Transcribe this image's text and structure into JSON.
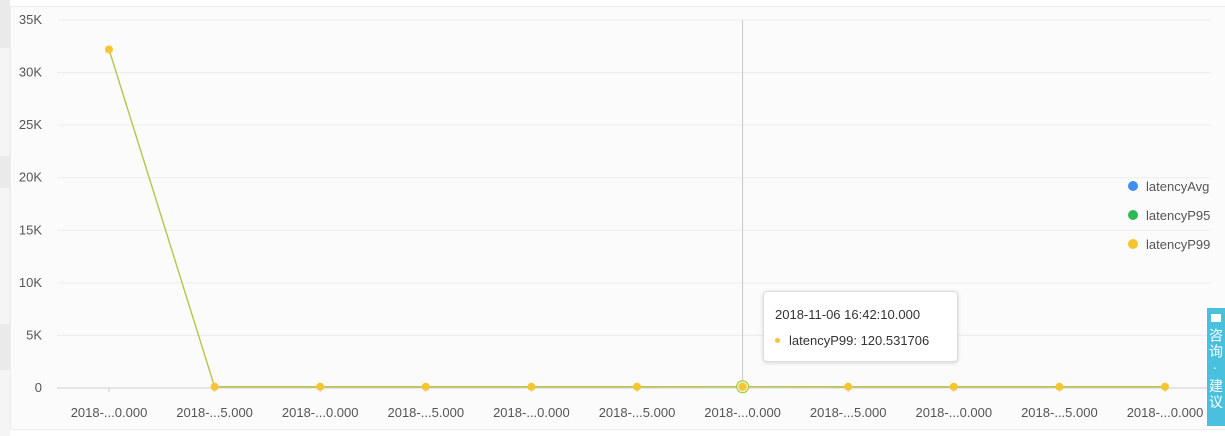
{
  "chart_data": {
    "type": "line",
    "title": "",
    "xlabel": "",
    "ylabel": "",
    "ylim": [
      0,
      35000
    ],
    "yticks": [
      {
        "value": 0,
        "label": "0"
      },
      {
        "value": 5000,
        "label": "5K"
      },
      {
        "value": 10000,
        "label": "10K"
      },
      {
        "value": 15000,
        "label": "15K"
      },
      {
        "value": 20000,
        "label": "20K"
      },
      {
        "value": 25000,
        "label": "25K"
      },
      {
        "value": 30000,
        "label": "30K"
      },
      {
        "value": 35000,
        "label": "35K"
      }
    ],
    "categories": [
      "2018-...0.000",
      "2018-...5.000",
      "2018-...0.000",
      "2018-...5.000",
      "2018-...0.000",
      "2018-...5.000",
      "2018-...0.000",
      "2018-...5.000",
      "2018-...0.000",
      "2018-...5.000",
      "2018-...0.000"
    ],
    "grid": true,
    "legend_position": "right",
    "series": [
      {
        "name": "latencyAvg",
        "color": "#3f8ef0",
        "values": []
      },
      {
        "name": "latencyP95",
        "color": "#2fb956",
        "values": []
      },
      {
        "name": "latencyP99",
        "color": "#f5c62e",
        "values": [
          32200,
          120,
          120,
          120,
          120,
          120,
          120.531706,
          120,
          120,
          120,
          120
        ]
      }
    ],
    "highlight_index": 6
  },
  "tooltip": {
    "title": "2018-11-06 16:42:10.000",
    "series_name": "latencyP99",
    "value": "120.531706",
    "color": "#f5c62e"
  },
  "side_tab": {
    "text": "咨询 · 建议",
    "color": "#4ac0df"
  }
}
